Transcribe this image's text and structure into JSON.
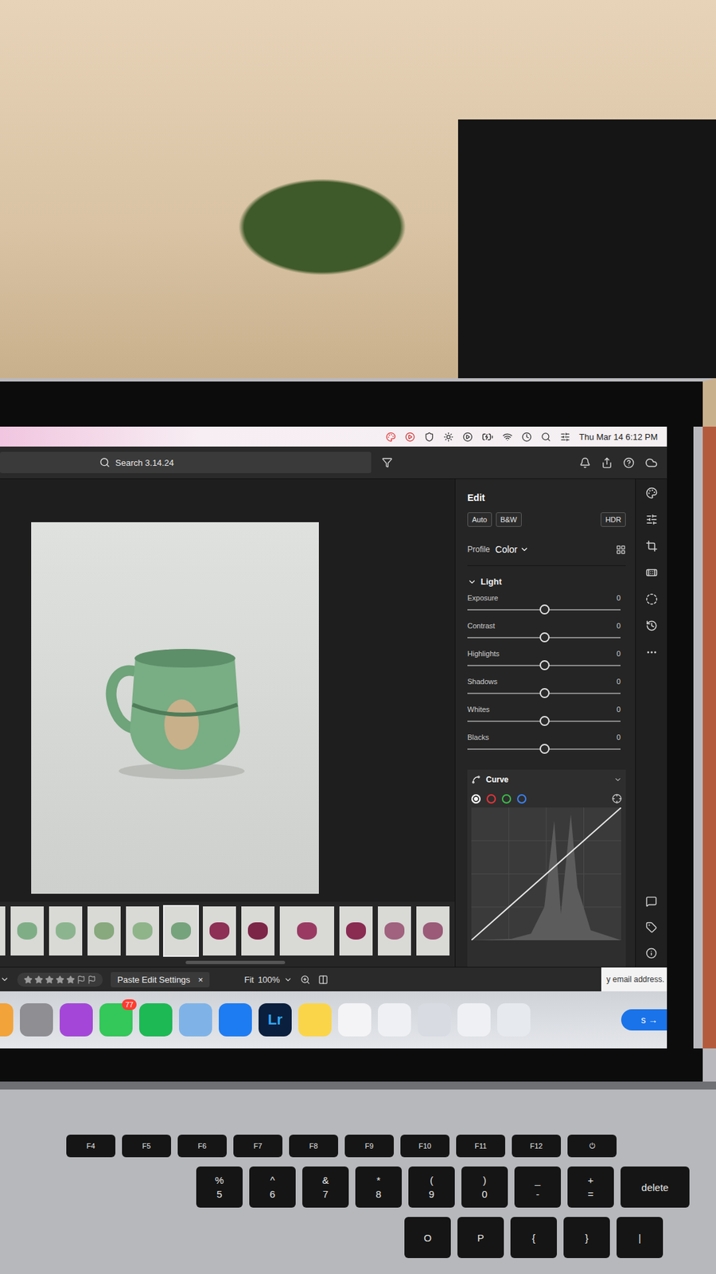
{
  "menubar": {
    "datetime": "Thu Mar 14  6:12 PM"
  },
  "toolbar": {
    "search": "Search 3.14.24"
  },
  "edit": {
    "title": "Edit",
    "presets": [
      "Auto",
      "B&W"
    ],
    "hdr": "HDR",
    "profile": {
      "label": "Profile",
      "value": "Color"
    },
    "light": {
      "title": "Light",
      "expanded": true,
      "sliders": [
        {
          "label": "Exposure",
          "value": "0",
          "level": 0.5
        },
        {
          "label": "Contrast",
          "value": "0",
          "level": 0.5
        },
        {
          "label": "Highlights",
          "value": "0",
          "level": 0.5
        },
        {
          "label": "Shadows",
          "value": "0",
          "level": 0.5
        },
        {
          "label": "Whites",
          "value": "0",
          "level": 0.5
        },
        {
          "label": "Blacks",
          "value": "0",
          "level": 0.5
        }
      ]
    },
    "curve": {
      "title": "Curve",
      "channels": [
        {
          "color": "#ffffff",
          "selected": true
        },
        {
          "color": "#e5343a",
          "selected": false
        },
        {
          "color": "#3dbb4a",
          "selected": false
        },
        {
          "color": "#3b82f6",
          "selected": false
        }
      ]
    }
  },
  "filmstrip": [
    {
      "color": "#7fae86",
      "selected": false
    },
    {
      "color": "#7fae86",
      "selected": false
    },
    {
      "color": "#8cb58f",
      "selected": false
    },
    {
      "color": "#87a97d",
      "selected": false
    },
    {
      "color": "#8fb48a",
      "selected": false
    },
    {
      "color": "#76a37c",
      "selected": true
    },
    {
      "color": "#8e2f55",
      "selected": false
    },
    {
      "color": "#7d2547",
      "selected": false
    },
    {
      "color": "#9a3a63",
      "selected": false
    },
    {
      "color": "#8a2b52",
      "selected": false
    },
    {
      "color": "#a0627e",
      "selected": false
    },
    {
      "color": "#9a5a78",
      "selected": false
    }
  ],
  "bottombar": {
    "stars": 0,
    "paste": "Paste Edit Settings",
    "close": "×",
    "fit": "Fit",
    "zoom": "100%"
  },
  "background_page": {
    "text": "y email address.",
    "button": "s →"
  },
  "dock": [
    {
      "color": "#f2a33a",
      "label": "",
      "badge": ""
    },
    {
      "color": "#8e8e93",
      "label": "",
      "badge": ""
    },
    {
      "color": "#a447d8",
      "label": "",
      "badge": ""
    },
    {
      "color": "#34c759",
      "label": "",
      "badge": "77"
    },
    {
      "color": "#1db954",
      "label": "",
      "badge": ""
    },
    {
      "color": "#7fb3e8",
      "label": "",
      "badge": ""
    },
    {
      "color": "#1e7cf2",
      "label": "",
      "badge": ""
    },
    {
      "color": "#0a1f3d",
      "label": "Lr",
      "badge": ""
    },
    {
      "color": "#fbd549",
      "label": "",
      "badge": ""
    },
    {
      "color": "#f4f4f6",
      "label": "",
      "badge": ""
    },
    {
      "color": "#eef0f4",
      "label": "",
      "badge": ""
    },
    {
      "color": "#d8dbe2",
      "label": "",
      "badge": ""
    },
    {
      "color": "#eef0f4",
      "label": "",
      "badge": ""
    },
    {
      "color": "#e6e9ee",
      "label": "",
      "badge": ""
    }
  ],
  "keyboard": {
    "rows": [
      [
        {
          "top": "",
          "bottom": "F4"
        },
        {
          "top": "",
          "bottom": "F5"
        },
        {
          "top": "",
          "bottom": "F6"
        },
        {
          "top": "",
          "bottom": "F7"
        },
        {
          "top": "",
          "bottom": "F8"
        },
        {
          "top": "",
          "bottom": "F9"
        },
        {
          "top": "",
          "bottom": "F10"
        },
        {
          "top": "",
          "bottom": "F11"
        },
        {
          "top": "",
          "bottom": "F12"
        },
        {
          "top": "⏻",
          "bottom": ""
        }
      ],
      [
        {
          "top": "%",
          "bottom": "5"
        },
        {
          "top": "^",
          "bottom": "6"
        },
        {
          "top": "&",
          "bottom": "7"
        },
        {
          "top": "*",
          "bottom": "8"
        },
        {
          "top": "(",
          "bottom": "9"
        },
        {
          "top": ")",
          "bottom": "0"
        },
        {
          "top": "_",
          "bottom": "-"
        },
        {
          "top": "+",
          "bottom": "="
        },
        {
          "top": "",
          "bottom": "delete"
        }
      ],
      [
        {
          "top": "O",
          "bottom": ""
        },
        {
          "top": "P",
          "bottom": ""
        },
        {
          "top": "{",
          "bottom": ""
        },
        {
          "top": "}",
          "bottom": ""
        },
        {
          "top": "|",
          "bottom": ""
        }
      ]
    ]
  }
}
